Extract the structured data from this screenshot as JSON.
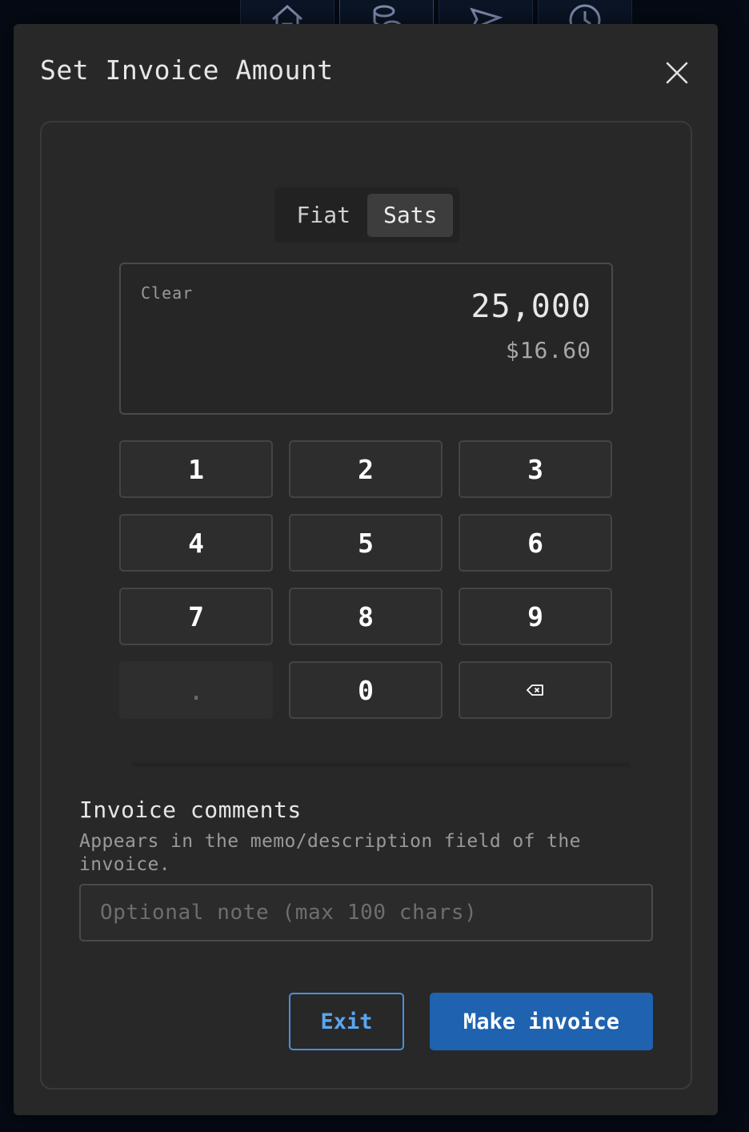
{
  "background_nav": {
    "items": [
      {
        "icon": "home-icon"
      },
      {
        "icon": "coins-icon",
        "active": true
      },
      {
        "icon": "send-icon"
      },
      {
        "icon": "history-icon"
      }
    ]
  },
  "modal": {
    "title": "Set Invoice Amount",
    "close_icon": "close-icon"
  },
  "unit_toggle": {
    "options": [
      "Fiat",
      "Sats"
    ],
    "selected": "Sats"
  },
  "amount_display": {
    "clear_label": "Clear",
    "amount": "25,000",
    "fiat_equivalent": "$16.60"
  },
  "keypad": {
    "keys": [
      "1",
      "2",
      "3",
      "4",
      "5",
      "6",
      "7",
      "8",
      "9",
      ".",
      "0"
    ],
    "backspace_icon": "backspace-icon"
  },
  "comments": {
    "label": "Invoice comments",
    "help_text": "Appears in the memo/description field of the invoice.",
    "value": "",
    "placeholder": "Optional note (max 100 chars)"
  },
  "footer": {
    "exit_label": "Exit",
    "make_invoice_label": "Make invoice"
  },
  "colors": {
    "accent": "#1e62b0",
    "accent_outline": "#4a90d9",
    "modal_bg": "#282828"
  }
}
